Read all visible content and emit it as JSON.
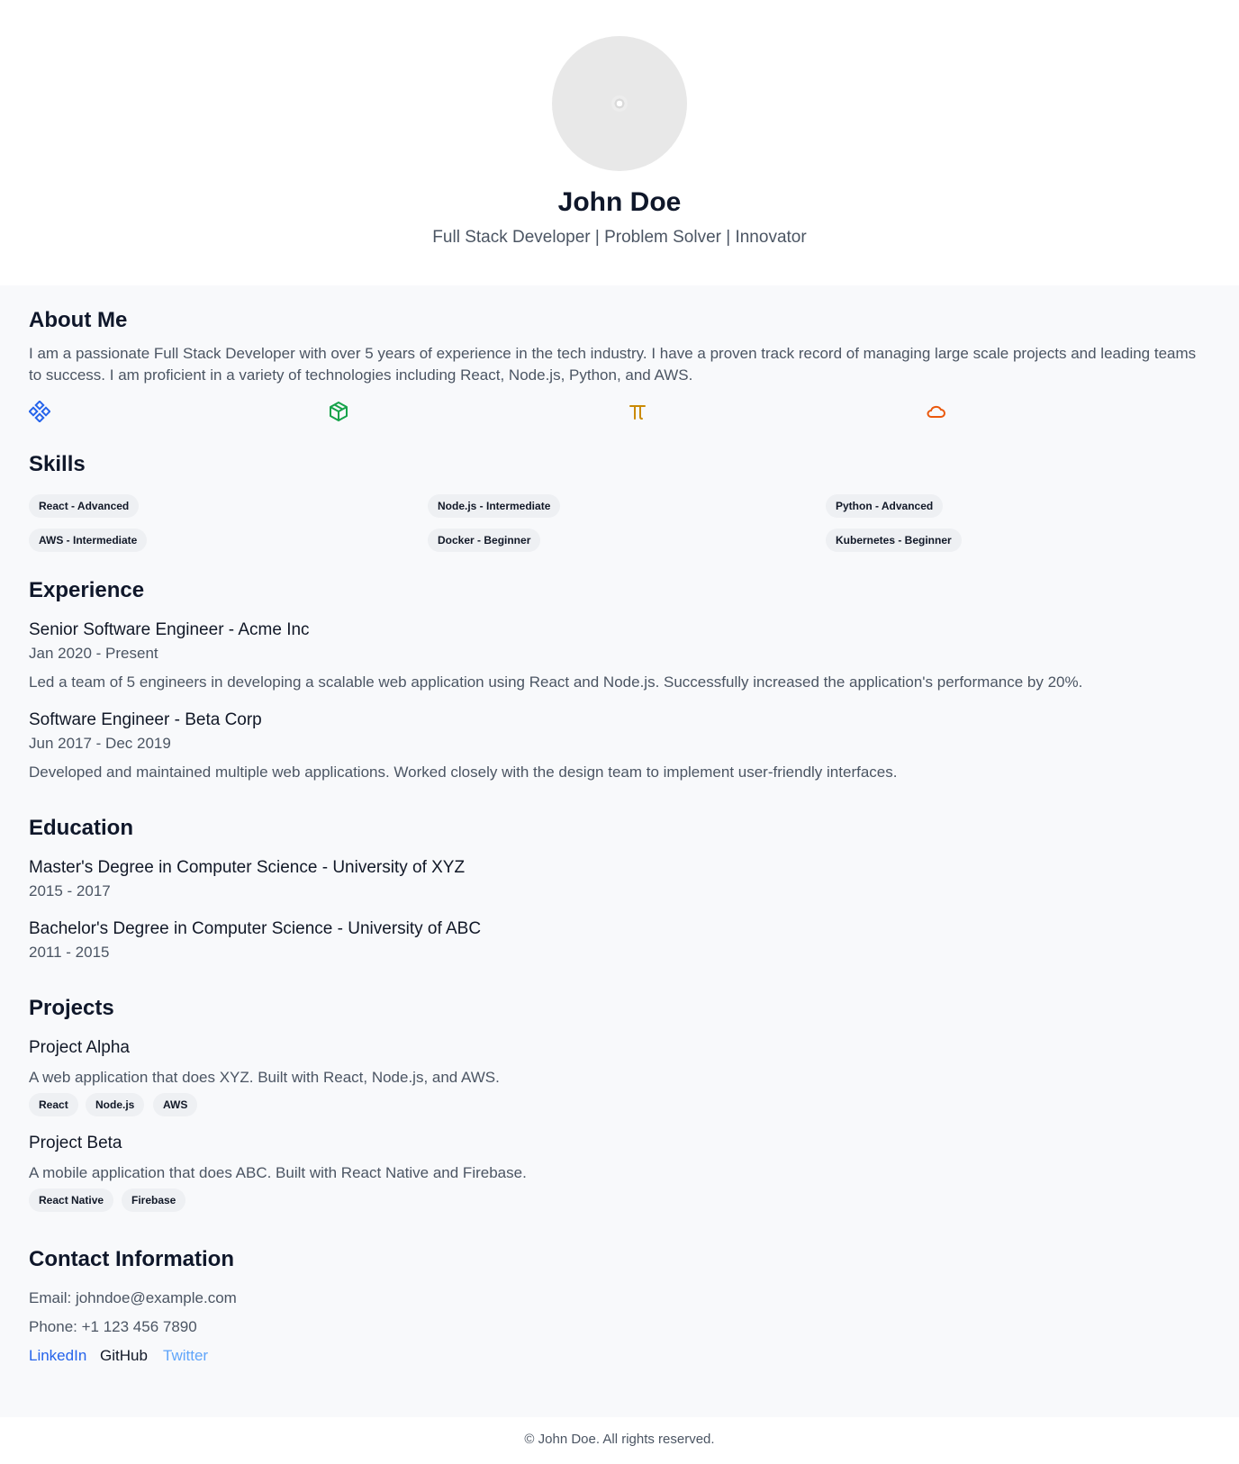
{
  "profile": {
    "name": "John Doe",
    "tagline": "Full Stack Developer | Problem Solver | Innovator"
  },
  "about": {
    "heading": "About Me",
    "text_line1": "I am a passionate Full Stack Developer with over 5 years of experience in the tech industry. I have a proven track record of managing large scale projects and leading teams",
    "text_line2": "to success. I am proficient in a variety of technologies including React, Node.js, Python, and AWS.",
    "icons": [
      "react-icon",
      "nodejs-icon",
      "python-icon",
      "aws-icon"
    ],
    "icon_colors": [
      "#2563eb",
      "#16a34a",
      "#ca8a04",
      "#ea580c"
    ]
  },
  "skills": {
    "heading": "Skills",
    "items": [
      "React - Advanced",
      "Node.js - Intermediate",
      "Python - Advanced",
      "AWS - Intermediate",
      "Docker - Beginner",
      "Kubernetes - Beginner"
    ]
  },
  "experience": {
    "heading": "Experience",
    "items": [
      {
        "title": "Senior Software Engineer - Acme Inc",
        "dates": "Jan 2020 - Present",
        "description": "Led a team of 5 engineers in developing a scalable web application using React and Node.js. Successfully increased the application's performance by 20%."
      },
      {
        "title": "Software Engineer - Beta Corp",
        "dates": "Jun 2017 - Dec 2019",
        "description": "Developed and maintained multiple web applications. Worked closely with the design team to implement user-friendly interfaces."
      }
    ]
  },
  "education": {
    "heading": "Education",
    "items": [
      {
        "title": "Master's Degree in Computer Science - University of XYZ",
        "dates": "2015 - 2017"
      },
      {
        "title": "Bachelor's Degree in Computer Science - University of ABC",
        "dates": "2011 - 2015"
      }
    ]
  },
  "projects": {
    "heading": "Projects",
    "items": [
      {
        "title": "Project Alpha",
        "description": "A web application that does XYZ. Built with React, Node.js, and AWS.",
        "tags": [
          "React",
          "Node.js",
          "AWS"
        ]
      },
      {
        "title": "Project Beta",
        "description": "A mobile application that does ABC. Built with React Native and Firebase.",
        "tags": [
          "React Native",
          "Firebase"
        ]
      }
    ]
  },
  "contact": {
    "heading": "Contact Information",
    "email": "Email: johndoe@example.com",
    "phone": "Phone: +1 123 456 7890",
    "links": {
      "linkedin": "LinkedIn",
      "github": "GitHub",
      "twitter": "Twitter"
    }
  },
  "footer": {
    "text": "© John Doe. All rights reserved."
  }
}
